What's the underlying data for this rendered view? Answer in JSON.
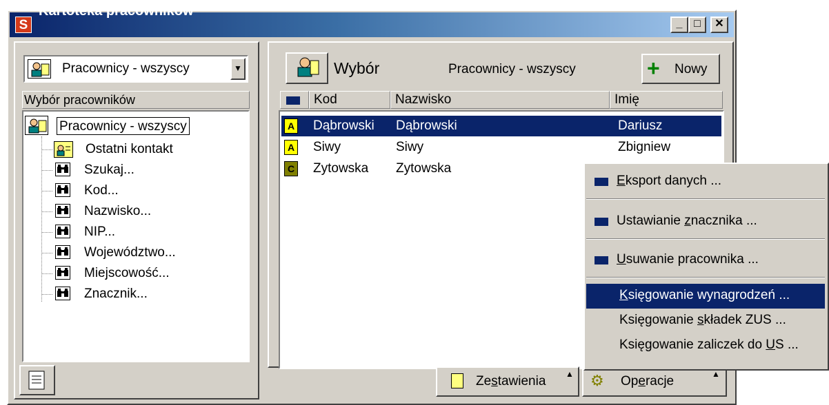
{
  "window": {
    "title": "Kartoteka pracowników",
    "icon_letter": "S"
  },
  "left": {
    "combo_value": "Pracownicy - wszyscy",
    "section_label": "Wybór pracowników",
    "tree_root": "Pracownicy - wszyscy",
    "tree_items": [
      "Ostatni kontakt",
      "Szukaj...",
      "Kod...",
      "Nazwisko...",
      "NIP...",
      "Województwo...",
      "Miejscowość...",
      "Znacznik..."
    ]
  },
  "right": {
    "header_title": "Wybór",
    "header_subtitle": "Pracownicy - wszyscy",
    "new_button": "Nowy",
    "columns": [
      "Kod",
      "Nazwisko",
      "Imię"
    ],
    "rows": [
      {
        "badge": "A",
        "kod": "Dąbrowski",
        "nazwisko": "Dąbrowski",
        "imie": "Dariusz",
        "selected": true
      },
      {
        "badge": "A",
        "kod": "Siwy",
        "nazwisko": "Siwy",
        "imie": "Zbigniew",
        "selected": false
      },
      {
        "badge": "C",
        "kod": "Zytowska",
        "nazwisko": "Zytowska",
        "imie": "",
        "selected": false
      }
    ]
  },
  "bottom": {
    "zestawienia": "Zestawienia",
    "operacje": "Operacje"
  },
  "menu": {
    "items": [
      {
        "pre": "",
        "u": "E",
        "post": "ksport danych ..."
      },
      {
        "pre": "Ustawianie ",
        "u": "z",
        "post": "nacznika ..."
      },
      {
        "pre": "",
        "u": "U",
        "post": "suwanie pracownika ..."
      },
      {
        "pre": "",
        "u": "K",
        "post": "sięgowanie wynagrodzeń ..."
      },
      {
        "pre": "Księgowanie ",
        "u": "s",
        "post": "kładek ZUS ..."
      },
      {
        "pre": "Księgowanie zaliczek do ",
        "u": "U",
        "post": "S ..."
      }
    ]
  },
  "colors": {
    "selection": "#0a246a",
    "badge_a": "#ffff00",
    "badge_c": "#808000",
    "face": "#d4d0c8"
  }
}
